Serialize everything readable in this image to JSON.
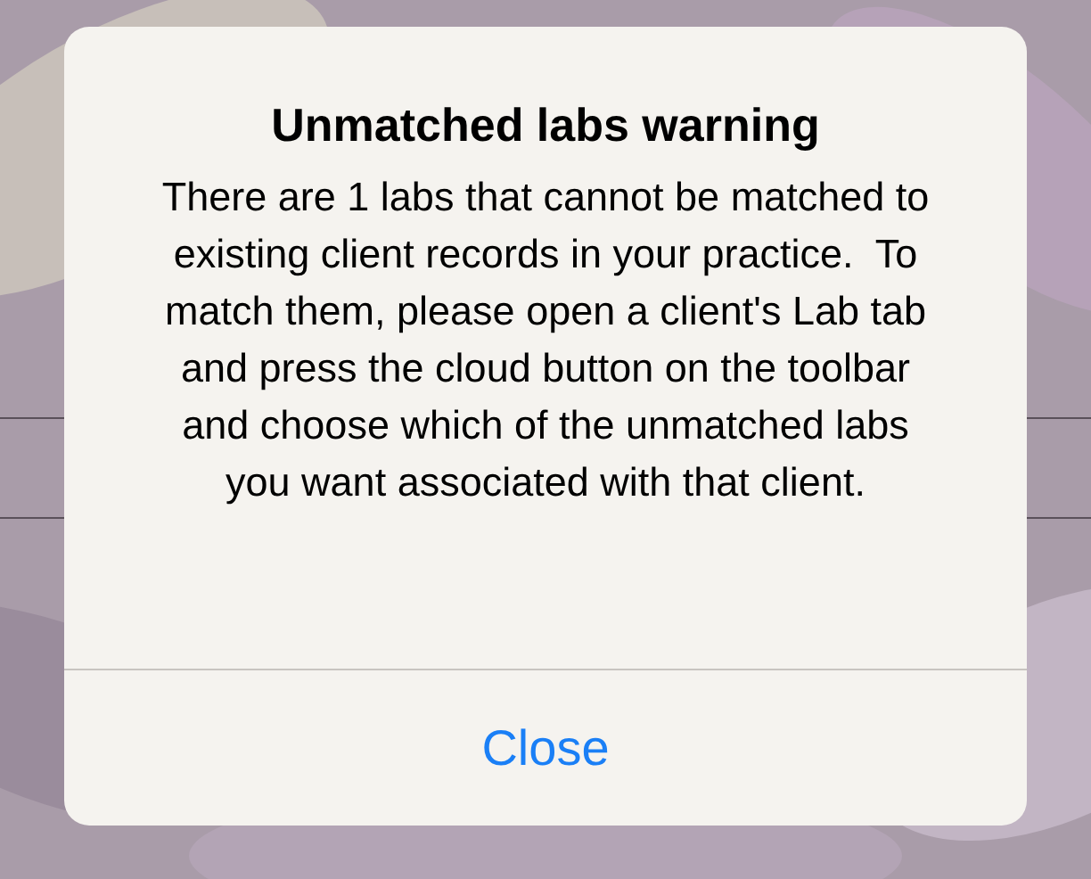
{
  "alert": {
    "title": "Unmatched labs warning",
    "message": "There are 1 labs that cannot be matched to existing client records in your practice.  To match them, please open a client's Lab tab and press the cloud button on the toolbar and choose which of the unmatched labs you want associated with that client.",
    "buttons": [
      {
        "label": "Close"
      }
    ]
  }
}
